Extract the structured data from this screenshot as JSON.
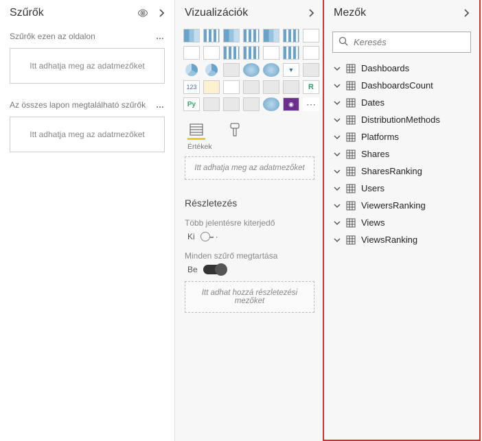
{
  "filters": {
    "title": "Szűrők",
    "pageFiltersLabel": "Szűrők ezen az oldalon",
    "dropHint": "Itt adhatja meg az adatmezőket",
    "allPagesLabel": "Az összes lapon megtalálható szűrők"
  },
  "viz": {
    "title": "Vizualizációk",
    "fieldsTabLabel": "Értékek",
    "valuesDropHint": "Itt adhatja meg az adatmezőket",
    "drillthroughTitle": "Részletezés",
    "crossReportLabel": "Több jelentésre kiterjedő",
    "crossReportValue": "Ki",
    "keepFiltersLabel": "Minden szűrő megtartása",
    "keepFiltersValue": "Be",
    "drillDropHint": "Itt adhat hozzá részletezési mezőket"
  },
  "fields": {
    "title": "Mezők",
    "searchPlaceholder": "Keresés",
    "items": [
      {
        "name": "Dashboards"
      },
      {
        "name": "DashboardsCount"
      },
      {
        "name": "Dates"
      },
      {
        "name": "DistributionMethods"
      },
      {
        "name": "Platforms"
      },
      {
        "name": "Shares"
      },
      {
        "name": "SharesRanking"
      },
      {
        "name": "Users"
      },
      {
        "name": "ViewersRanking"
      },
      {
        "name": "Views"
      },
      {
        "name": "ViewsRanking"
      }
    ]
  }
}
